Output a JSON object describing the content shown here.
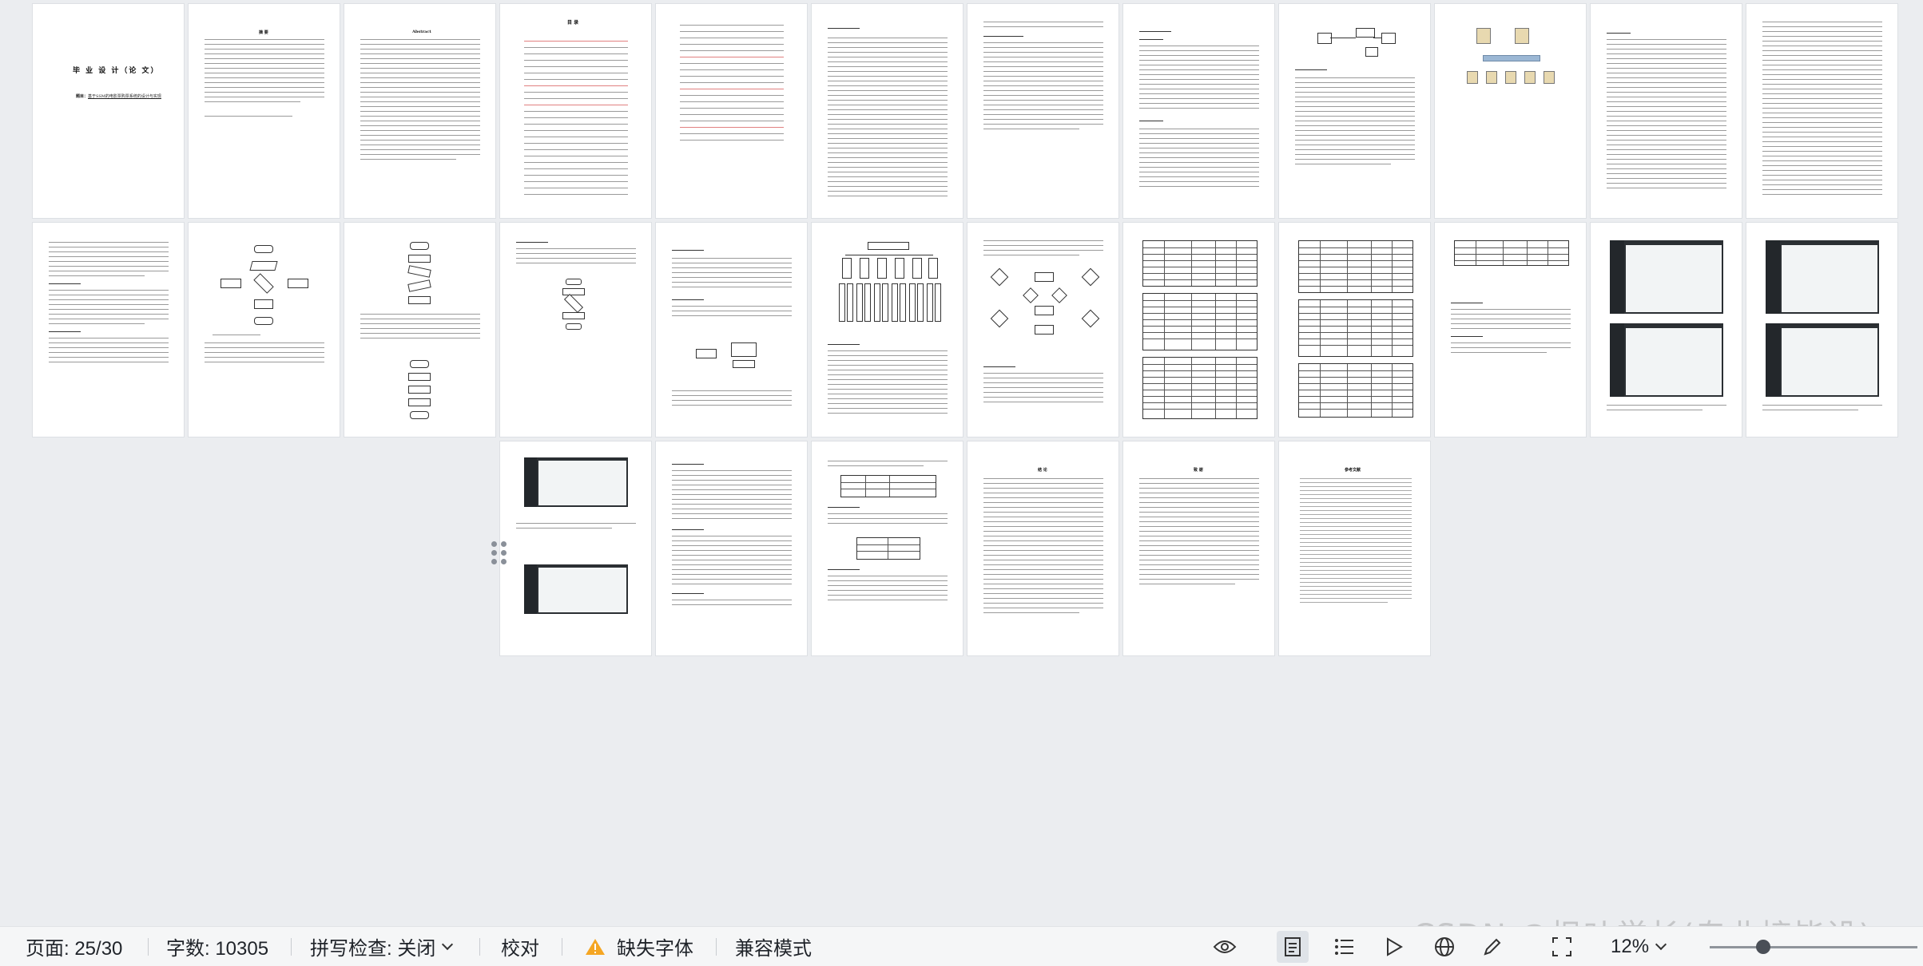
{
  "document": {
    "cover_title": "毕 业 设 计（论 文）",
    "cover_subtitle_label": "题目：",
    "cover_subtitle_value": "基于SSM的电影票购票系统的设计与实现",
    "abstract_cn_heading": "摘 要",
    "abstract_en_heading": "Abstract",
    "toc_heading": "目 录",
    "conclusion_heading": "结 论",
    "thanks_heading": "致 谢",
    "references_heading": "参考文献"
  },
  "statusbar": {
    "page_indicator": "页面: 25/30",
    "word_count": "字数: 10305",
    "spellcheck": "拼写检查: 关闭",
    "proofread": "校对",
    "missing_fonts": "缺失字体",
    "compat_mode": "兼容模式",
    "zoom": "12%"
  },
  "watermark": "CSDN @枫叶学长(专业接毕设)",
  "icons": {
    "warning": "warning-icon",
    "eye": "eye-icon",
    "page_view": "page-view-icon",
    "outline": "outline-icon",
    "play": "play-icon",
    "globe": "globe-icon",
    "pen": "pen-icon",
    "fit": "fit-page-icon"
  },
  "colors": {
    "warning": "#f5a623",
    "active_view": "#dfe3e8"
  }
}
